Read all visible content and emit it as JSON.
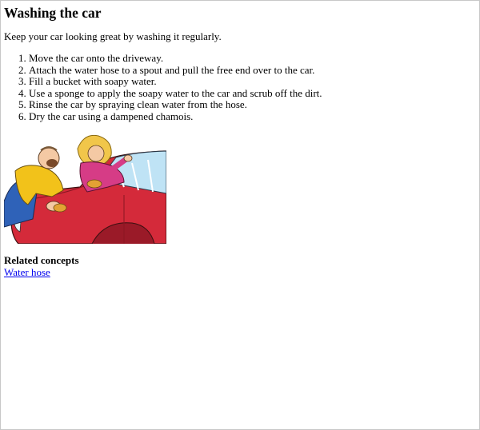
{
  "page": {
    "title": "Washing the car",
    "intro": "Keep your car looking great by washing it regularly."
  },
  "steps": [
    "Move the car onto the driveway.",
    "Attach the water hose to a spout and pull the free end over to the car.",
    "Fill a bucket with soapy water.",
    "Use a sponge to apply the soapy water to the car and scrub off the dirt.",
    "Rinse the car by spraying clean water from the hose.",
    "Dry the car using a dampened chamois."
  ],
  "illustration": {
    "icon": "car-washing-illustration",
    "colors": {
      "car": "#d42a3a",
      "man_shirt": "#f2c21a",
      "man_pants": "#2f62b8",
      "woman_shirt": "#d63c86",
      "woman_hair": "#f1c64a"
    }
  },
  "related": {
    "heading": "Related concepts",
    "links": [
      "Water hose"
    ],
    "link_color": "#0000ee"
  }
}
